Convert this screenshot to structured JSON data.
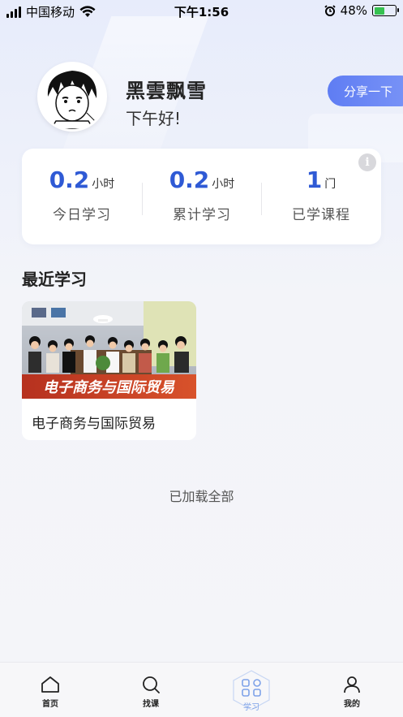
{
  "status_bar": {
    "carrier": "中国移动",
    "time": "下午1:56",
    "battery": "48%",
    "battery_level": 0.48
  },
  "profile": {
    "username": "黑雲飘雪",
    "greeting": "下午好!",
    "share_label": "分享一下"
  },
  "stats": [
    {
      "value": "0.2",
      "unit": "小时",
      "label": "今日学习"
    },
    {
      "value": "0.2",
      "unit": "小时",
      "label": "累计学习"
    },
    {
      "value": "1",
      "unit": "门",
      "label": "已学课程"
    }
  ],
  "recent": {
    "title": "最近学习",
    "courses": [
      {
        "name": "电子商务与国际贸易",
        "banner": "电子商务与国际贸易"
      }
    ]
  },
  "footer_note": "已加载全部",
  "tabs": [
    {
      "label": "首页",
      "icon": "home-icon"
    },
    {
      "label": "找课",
      "icon": "search-icon"
    },
    {
      "label": "学习",
      "icon": "study-icon"
    },
    {
      "label": "我的",
      "icon": "user-icon"
    }
  ],
  "colors": {
    "accent": "#2f5ad5",
    "share_button": "#6a86f5",
    "active_tab": "#7ea2e8",
    "battery_fill": "#36c150"
  }
}
